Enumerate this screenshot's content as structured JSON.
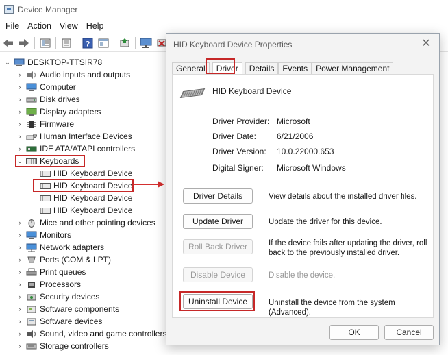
{
  "window": {
    "title": "Device Manager"
  },
  "menu": [
    "File",
    "Action",
    "View",
    "Help"
  ],
  "toolbar": [
    "back-icon",
    "forward-icon",
    "properties-icon",
    "scan-icon",
    "help-icon",
    "view-icon",
    "update-driver-icon",
    "monitor-icon",
    "remove-icon",
    "download-icon"
  ],
  "tree": {
    "root": "DESKTOP-TTSIR78",
    "items": [
      "Audio inputs and outputs",
      "Computer",
      "Disk drives",
      "Display adapters",
      "Firmware",
      "Human Interface Devices",
      "IDE ATA/ATAPI controllers",
      "Keyboards",
      "HID Keyboard Device",
      "HID Keyboard Device",
      "HID Keyboard Device",
      "HID Keyboard Device",
      "Mice and other pointing devices",
      "Monitors",
      "Network adapters",
      "Ports (COM & LPT)",
      "Print queues",
      "Processors",
      "Security devices",
      "Software components",
      "Software devices",
      "Sound, video and game controllers",
      "Storage controllers"
    ]
  },
  "dialog": {
    "title": "HID Keyboard Device Properties",
    "close": "✕",
    "tabs": [
      "General",
      "Driver",
      "Details",
      "Events",
      "Power Management"
    ],
    "device_name": "HID Keyboard Device",
    "info": [
      {
        "label": "Driver Provider:",
        "value": "Microsoft"
      },
      {
        "label": "Driver Date:",
        "value": "6/21/2006"
      },
      {
        "label": "Driver Version:",
        "value": "10.0.22000.653"
      },
      {
        "label": "Digital Signer:",
        "value": "Microsoft Windows"
      }
    ],
    "actions": [
      {
        "label": "Driver Details",
        "desc": "View details about the installed driver files."
      },
      {
        "label": "Update Driver",
        "desc": "Update the driver for this device."
      },
      {
        "label": "Roll Back Driver",
        "desc": "If the device fails after updating the driver, roll back to the previously installed driver."
      },
      {
        "label": "Disable Device",
        "desc": "Disable the device."
      },
      {
        "label": "Uninstall Device",
        "desc": "Uninstall the device from the system (Advanced)."
      }
    ],
    "ok": "OK",
    "cancel": "Cancel"
  },
  "colors": {
    "highlight": "#c62828",
    "arrow": "#d32f2f"
  }
}
